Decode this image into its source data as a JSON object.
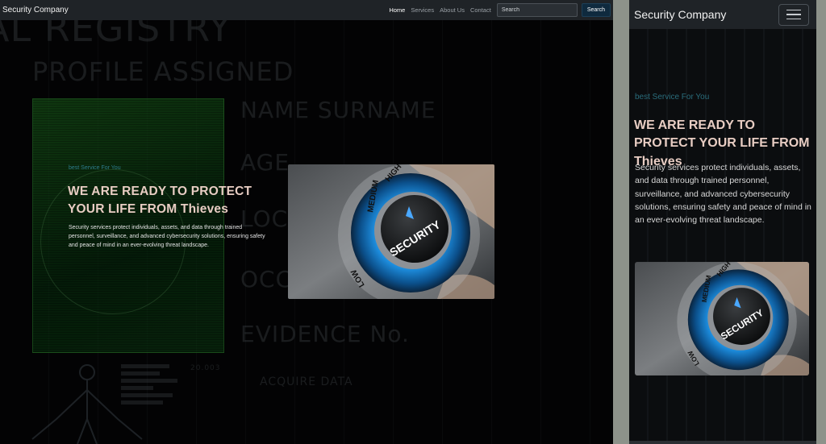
{
  "desktop": {
    "nav": {
      "brand": "Security Company",
      "links": [
        "Home",
        "Services",
        "About Us",
        "Contact"
      ],
      "search_placeholder": "Search",
      "search_button": "Search"
    },
    "background_text": {
      "registry": "AL REGISTRY",
      "profile": "PROFILE ASSIGNED",
      "name": "NAME SURNAME",
      "age": "AGE",
      "loc": "LOC",
      "occ": "OCC",
      "evidence": "EVIDENCE No.",
      "acquire": "ACQUIRE DATA",
      "number": "20.003"
    },
    "hero": {
      "tagline": "best Service For You",
      "title": "WE ARE READY TO PROTECT YOUR LIFE FROM Thieves",
      "description": "Security services protect individuals, assets, and data through trained personnel, surveillance, and advanced cybersecurity solutions, ensuring safety and peace of mind in an ever-evolving threat landscape."
    },
    "image": {
      "knob_label": "SECURITY",
      "scale_low": "LOW",
      "scale_medium": "MEDIUM",
      "scale_high": "HIGH"
    }
  },
  "mobile": {
    "nav": {
      "brand": "Security Company",
      "toggler_icon": "hamburger-icon"
    },
    "hero": {
      "tagline": "best Service For You",
      "title": "WE ARE READY TO PROTECT YOUR LIFE FROM Thieves",
      "description": "Security services protect individuals, assets, and data through trained personnel, surveillance, and advanced cybersecurity solutions, ensuring safety and peace of mind in an ever-evolving threat landscape."
    },
    "image": {
      "knob_label": "SECURITY",
      "scale_low": "LOW",
      "scale_medium": "MEDIUM",
      "scale_high": "HIGH"
    }
  },
  "colors": {
    "nav_bg": "#1f2327",
    "title": "#e8cdc3",
    "tagline": "#2e7d8c",
    "search_button_bg": "#0f2a3e"
  }
}
